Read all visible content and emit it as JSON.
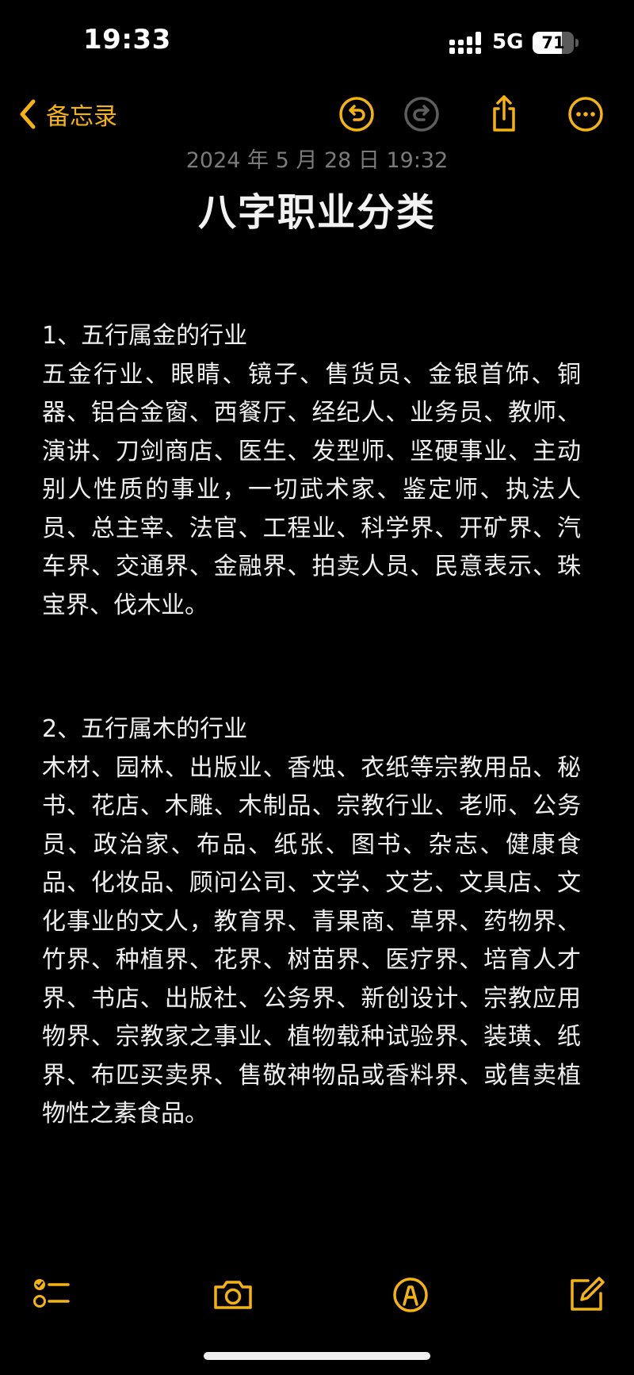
{
  "status_bar": {
    "time": "19:33",
    "network": "5G",
    "battery_level": "71",
    "battery_fraction": 0.71
  },
  "nav": {
    "back_label": "备忘录",
    "icons": [
      "chevron-left-icon",
      "undo-icon",
      "redo-icon",
      "share-icon",
      "more-icon"
    ]
  },
  "note": {
    "date": "2024 年 5 月 28 日 19:32",
    "title": "八字职业分类",
    "sections": [
      {
        "heading": "1、五行属金的行业",
        "text": "五金行业、眼睛、镜子、售货员、金银首饰、铜器、铝合金窗、西餐厅、经纪人、业务员、教师、演讲、刀剑商店、医生、发型师、坚硬事业、主动别人性质的事业，一切武术家、鉴定师、执法人员、总主宰、法官、工程业、科学界、开矿界、汽车界、交通界、金融界、拍卖人员、民意表示、珠宝界、伐木业。"
      },
      {
        "heading": "2、五行属木的行业",
        "text": "木材、园林、出版业、香烛、衣纸等宗教用品、秘书、花店、木雕、木制品、宗教行业、老师、公务员、政治家、布品、纸张、图书、杂志、健康食品、化妆品、顾问公司、文学、文艺、文具店、文化事业的文人，教育界、青果商、草界、药物界、竹界、种植界、花界、树苗界、医疗界、培育人才界、书店、出版社、公务界、新创设计、宗教应用物界、宗教家之事业、植物载种试验界、装璜、纸界、布匹买卖界、售敬神物品或香料界、或售卖植物性之素食品。"
      }
    ]
  },
  "toolbar": {
    "icons": [
      "checklist-icon",
      "camera-icon",
      "markup-pen-icon",
      "compose-icon"
    ]
  },
  "colors": {
    "accent": "#f5b30f",
    "accent_disabled": "#5e5e5e",
    "background": "#000000",
    "text": "#efefef",
    "meta_text": "#7b7b7b"
  }
}
